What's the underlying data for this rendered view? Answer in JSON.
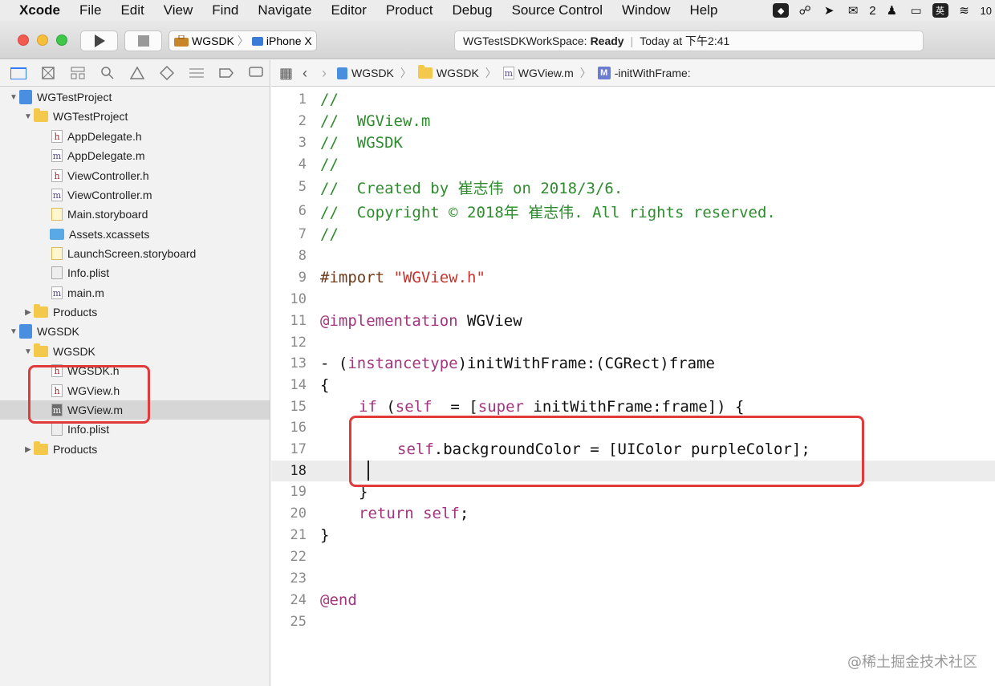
{
  "menubar": {
    "app": "Xcode",
    "items": [
      "File",
      "Edit",
      "View",
      "Find",
      "Navigate",
      "Editor",
      "Product",
      "Debug",
      "Source Control",
      "Window",
      "Help"
    ],
    "status": {
      "wechat_count": "2",
      "ime": "英",
      "clock": "10"
    }
  },
  "toolbar": {
    "scheme": "WGSDK",
    "device": "iPhone X",
    "activity_workspace": "WGTestSDKWorkSpace:",
    "activity_status": "Ready",
    "activity_time": "Today at 下午2:41"
  },
  "navigator": {
    "rows": [
      {
        "label": "WGTestProject"
      },
      {
        "label": "WGTestProject"
      },
      {
        "label": "AppDelegate.h"
      },
      {
        "label": "AppDelegate.m"
      },
      {
        "label": "ViewController.h"
      },
      {
        "label": "ViewController.m"
      },
      {
        "label": "Main.storyboard"
      },
      {
        "label": "Assets.xcassets"
      },
      {
        "label": "LaunchScreen.storyboard"
      },
      {
        "label": "Info.plist"
      },
      {
        "label": "main.m"
      },
      {
        "label": "Products"
      },
      {
        "label": "WGSDK"
      },
      {
        "label": "WGSDK"
      },
      {
        "label": "WGSDK.h"
      },
      {
        "label": "WGView.h"
      },
      {
        "label": "WGView.m"
      },
      {
        "label": "Info.plist"
      },
      {
        "label": "Products"
      }
    ]
  },
  "jumpbar": {
    "crumbs": [
      "WGSDK",
      "WGSDK",
      "WGView.m",
      "-initWithFrame:"
    ]
  },
  "editor": {
    "line_numbers": [
      "1",
      "2",
      "3",
      "4",
      "5",
      "6",
      "7",
      "8",
      "9",
      "10",
      "11",
      "12",
      "13",
      "14",
      "15",
      "16",
      "17",
      "18",
      "19",
      "20",
      "21",
      "22",
      "23",
      "24",
      "25"
    ],
    "current_line": "18",
    "code": {
      "l1": "//",
      "l2": "//  WGView.m",
      "l3": "//  WGSDK",
      "l4": "//",
      "l5": "//  Created by 崔志伟 on 2018/3/6.",
      "l6": "//  Copyright © 2018年 崔志伟. All rights reserved.",
      "l7": "//",
      "l9_kw": "#import",
      "l9_str": " \"WGView.h\"",
      "l11_kw": "@implementation",
      "l11_rest": " WGView",
      "l13_a": "- (",
      "l13_kw": "instancetype",
      "l13_b": ")initWithFrame:(CGRect)frame",
      "l14": "{",
      "l15_kw": "if",
      "l15_a": " (",
      "l15_self": "self",
      "l15_b": "  = [",
      "l15_super": "super",
      "l15_c": " initWithFrame:frame]) {",
      "l17_self": "self",
      "l17_rest": ".backgroundColor = [UIColor purpleColor];",
      "l19": "}",
      "l20_kw": "return",
      "l20_self": " self",
      "l20_end": ";",
      "l21": "}",
      "l24": "@end"
    }
  },
  "watermark": "@稀土掘金技术社区"
}
